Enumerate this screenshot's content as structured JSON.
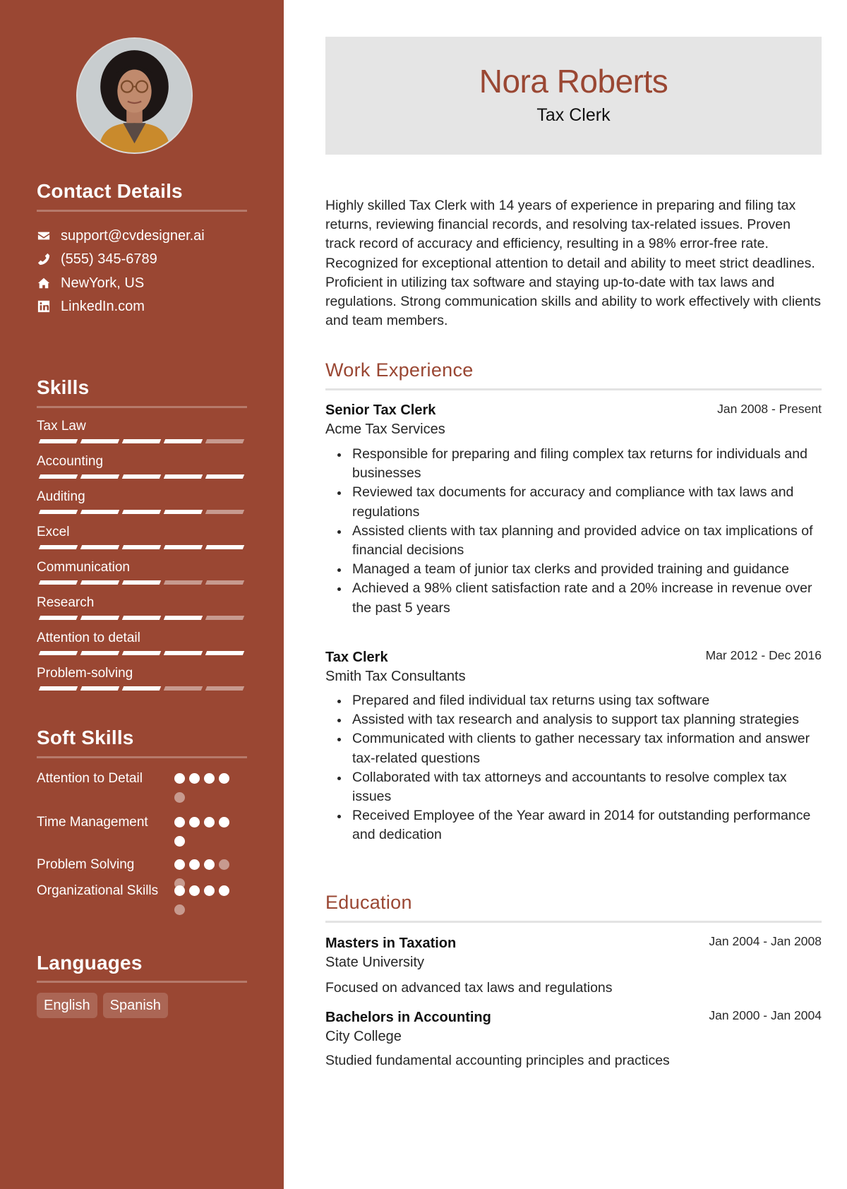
{
  "colors": {
    "accent": "#9a4733",
    "header_bg": "#e5e5e5",
    "divider": "#e3e3e3"
  },
  "profile": {
    "name": "Nora Roberts",
    "title": "Tax Clerk",
    "photo_alt": "profile-photo"
  },
  "contact": {
    "heading": "Contact Details",
    "items": [
      {
        "icon": "envelope-icon",
        "text": "support@cvdesigner.ai"
      },
      {
        "icon": "phone-icon",
        "text": "(555) 345-6789"
      },
      {
        "icon": "home-icon",
        "text": "NewYork, US"
      },
      {
        "icon": "linkedin-icon",
        "text": "LinkedIn.com"
      }
    ]
  },
  "skills": {
    "heading": "Skills",
    "max_level": 5,
    "items": [
      {
        "label": "Tax Law",
        "level": 4
      },
      {
        "label": "Accounting",
        "level": 5
      },
      {
        "label": "Auditing",
        "level": 4
      },
      {
        "label": "Excel",
        "level": 5
      },
      {
        "label": "Communication",
        "level": 3
      },
      {
        "label": "Research",
        "level": 4
      },
      {
        "label": "Attention to detail",
        "level": 5
      },
      {
        "label": "Problem-solving",
        "level": 3
      }
    ]
  },
  "soft_skills": {
    "heading": "Soft Skills",
    "max_level": 5,
    "items": [
      {
        "label": "Attention to Detail",
        "level": 4
      },
      {
        "label": "Time Management",
        "level": 5
      },
      {
        "label": "Problem Solving",
        "level": 3
      },
      {
        "label": "Organizational Skills",
        "level": 4
      }
    ]
  },
  "languages": {
    "heading": "Languages",
    "items": [
      "English",
      "Spanish"
    ]
  },
  "summary": "Highly skilled Tax Clerk with 14 years of experience in preparing and filing tax returns, reviewing financial records, and resolving tax-related issues. Proven track record of accuracy and efficiency, resulting in a 98% error-free rate. Recognized for exceptional attention to detail and ability to meet strict deadlines. Proficient in utilizing tax software and staying up-to-date with tax laws and regulations. Strong communication skills and ability to work effectively with clients and team members.",
  "work": {
    "heading": "Work Experience",
    "jobs": [
      {
        "title": "Senior Tax Clerk",
        "company": "Acme Tax Services",
        "dates": "Jan 2008 - Present",
        "bullets": [
          "Responsible for preparing and filing complex tax returns for individuals and businesses",
          "Reviewed tax documents for accuracy and compliance with tax laws and regulations",
          "Assisted clients with tax planning and provided advice on tax implications of financial decisions",
          "Managed a team of junior tax clerks and provided training and guidance",
          "Achieved a 98% client satisfaction rate and a 20% increase in revenue over the past 5 years"
        ]
      },
      {
        "title": "Tax Clerk",
        "company": "Smith Tax Consultants",
        "dates": "Mar 2012 - Dec 2016",
        "bullets": [
          "Prepared and filed individual tax returns using tax software",
          "Assisted with tax research and analysis to support tax planning strategies",
          "Communicated with clients to gather necessary tax information and answer tax-related questions",
          "Collaborated with tax attorneys and accountants to resolve complex tax issues",
          "Received Employee of the Year award in 2014 for outstanding performance and dedication"
        ]
      }
    ]
  },
  "education": {
    "heading": "Education",
    "items": [
      {
        "degree": "Masters in Taxation",
        "school": "State University",
        "dates": "Jan 2004 - Jan 2008",
        "description": "Focused on advanced tax laws and regulations"
      },
      {
        "degree": "Bachelors in Accounting",
        "school": "City College",
        "dates": "Jan 2000 - Jan 2004",
        "description": "Studied fundamental accounting principles and practices"
      }
    ]
  }
}
